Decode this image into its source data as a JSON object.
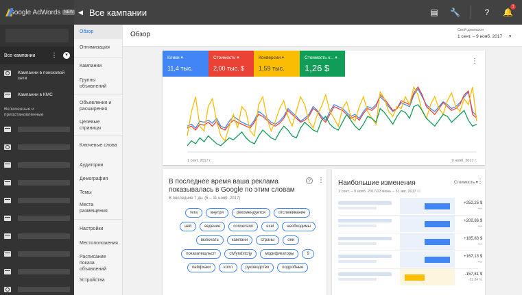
{
  "app": {
    "brand": "Google AdWords",
    "brand_badge": "NEW",
    "title": "Все кампании"
  },
  "topbar_icons": [
    "reports-icon",
    "tools-icon",
    "help-icon",
    "notifications-icon"
  ],
  "notification_count": "1",
  "leftnav": {
    "all_campaigns": "Все кампании",
    "items": [
      {
        "label": "Кампании в поисковой сети",
        "icon": "search-icon"
      },
      {
        "label": "Кампании в КМС",
        "icon": "display-icon"
      }
    ],
    "section": "Включенные и приостановленные",
    "campaign_icons": [
      "display-icon",
      "search-icon",
      "display-icon",
      "display-icon",
      "display-icon",
      "display-icon",
      "display-icon",
      "display-icon",
      "display-icon",
      "search-icon"
    ]
  },
  "submenu": [
    {
      "label": "Обзор",
      "active": true,
      "top": 0
    },
    {
      "label": "Оптимизация",
      "active": false
    },
    {
      "label": "Кампании",
      "active": false
    },
    {
      "label": "Группы объявлений",
      "active": false
    },
    {
      "label": "Объявления и расширения",
      "active": false
    },
    {
      "label": "Целевые страницы",
      "active": false
    },
    {
      "label": "Ключевые слова",
      "active": false
    },
    {
      "label": "Аудитории",
      "active": false
    },
    {
      "label": "Демография",
      "active": false
    },
    {
      "label": "Темы",
      "active": false
    },
    {
      "label": "Места размещения",
      "active": false
    },
    {
      "label": "Настройки",
      "active": false
    },
    {
      "label": "Местоположения",
      "active": false
    },
    {
      "label": "Расписание показа объявлений",
      "active": false
    },
    {
      "label": "Устройства",
      "active": false
    }
  ],
  "main": {
    "title": "Обзор",
    "date_caption": "Свой диапазон",
    "date_range": "1 сент. – 9 нояб. 2017"
  },
  "metrics": [
    {
      "label": "Клики",
      "value": "11,4 тыс.",
      "color": "#4285f4"
    },
    {
      "label": "Стоимость",
      "value": "2,00 тыс. $",
      "color": "#ea4335"
    },
    {
      "label": "Конверсии",
      "value": "1,59 тыс.",
      "color": "#fbbc04",
      "text_color": "#3c3c3c"
    },
    {
      "label": "Стоимость к...",
      "value": "1,26 $",
      "color": "#0f9d58"
    }
  ],
  "chart_data": {
    "type": "line",
    "x_start_label": "1 сент. 2017 г.",
    "x_end_label": "9 нояб. 2017 г.",
    "x_count": 70,
    "series": [
      {
        "name": "Клики",
        "color": "#4285f4",
        "values": [
          40,
          42,
          38,
          45,
          44,
          46,
          43,
          48,
          40,
          38,
          45,
          50,
          47,
          44,
          42,
          40,
          46,
          55,
          52,
          48,
          44,
          42,
          45,
          50,
          58,
          54,
          50,
          45,
          48,
          52,
          60,
          56,
          50,
          46,
          55,
          62,
          60,
          58,
          54,
          50,
          52,
          48,
          55,
          60,
          58,
          62,
          70,
          66,
          60,
          55,
          58,
          64,
          62,
          60,
          72,
          78,
          70,
          62,
          58,
          55,
          60,
          65,
          62,
          58,
          60,
          64,
          70,
          75,
          55,
          50
        ]
      },
      {
        "name": "Стоимость",
        "color": "#ea4335",
        "values": [
          38,
          40,
          36,
          42,
          41,
          44,
          40,
          45,
          38,
          36,
          42,
          46,
          44,
          42,
          40,
          38,
          44,
          52,
          50,
          46,
          42,
          40,
          43,
          48,
          56,
          52,
          48,
          44,
          46,
          50,
          58,
          55,
          48,
          44,
          52,
          60,
          58,
          56,
          52,
          48,
          50,
          46,
          53,
          58,
          56,
          60,
          72,
          68,
          62,
          56,
          58,
          66,
          64,
          62,
          74,
          80,
          72,
          60,
          56,
          52,
          58,
          64,
          60,
          56,
          58,
          62,
          72,
          76,
          52,
          48
        ]
      },
      {
        "name": "Конверсии",
        "color": "#fbbc04",
        "values": [
          30,
          55,
          70,
          40,
          35,
          60,
          68,
          45,
          30,
          25,
          40,
          52,
          38,
          60,
          55,
          35,
          30,
          62,
          70,
          48,
          35,
          45,
          58,
          66,
          50,
          40,
          55,
          70,
          62,
          45,
          38,
          52,
          60,
          72,
          55,
          48,
          40,
          58,
          65,
          50,
          45,
          60,
          70,
          55,
          48,
          42,
          75,
          68,
          55,
          50,
          60,
          58,
          70,
          62,
          80,
          72,
          55,
          48,
          62,
          70,
          58,
          52,
          66,
          74,
          60,
          55,
          68,
          62,
          80,
          45
        ]
      },
      {
        "name": "Стоимость к...",
        "color": "#0f9d58",
        "values": [
          20,
          25,
          22,
          28,
          24,
          30,
          26,
          22,
          20,
          24,
          28,
          26,
          30,
          34,
          28,
          24,
          22,
          30,
          36,
          32,
          28,
          26,
          34,
          40,
          36,
          30,
          28,
          38,
          44,
          40,
          36,
          34,
          46,
          50,
          42,
          38,
          36,
          44,
          52,
          46,
          40,
          36,
          42,
          50,
          48,
          44,
          58,
          54,
          48,
          42,
          50,
          56,
          54,
          48,
          60,
          62,
          56,
          48,
          44,
          40,
          46,
          52,
          50,
          44,
          48,
          52,
          56,
          46,
          40,
          42
        ]
      }
    ]
  },
  "keywords_card": {
    "title": "В последнее время ваша реклама показывалась в Google по этим словам",
    "subtitle": "В последние 7 дн. (5 – 11 нояб. 2017)",
    "rows": [
      [
        "тега",
        "внутри",
        "рекомендуется",
        "отслеживание"
      ],
      [
        "ней",
        "ведение",
        "conversion",
        "exel",
        "необходимы"
      ],
      [
        "включать",
        "кампани",
        "страны",
        "они"
      ],
      [
        "показатещльстг",
        "ctvfyndxtcrjy",
        "модификаторы",
        "9"
      ],
      [
        "лайфхаки",
        "колл",
        "руководство",
        "подробные"
      ]
    ]
  },
  "changes_card": {
    "title": "Наибольшие изменения",
    "subtitle": "1 сент. – 9 нояб. 2017/23 июнь – 31 авг. 2017",
    "sort_label": "Стоимость",
    "rows": [
      {
        "value": "+252,25 $",
        "pct": "+∞",
        "fraction": 0.46
      },
      {
        "value": "+202,86 $",
        "pct": "+∞",
        "fraction": 0.46
      },
      {
        "value": "+185,83 $",
        "pct": "+∞",
        "fraction": 0.46
      },
      {
        "value": "+167,13 $",
        "pct": "+∞",
        "fraction": 0.46
      },
      {
        "value": "-157,81 $",
        "pct": "-52,84 %",
        "fraction": -0.36
      }
    ]
  }
}
